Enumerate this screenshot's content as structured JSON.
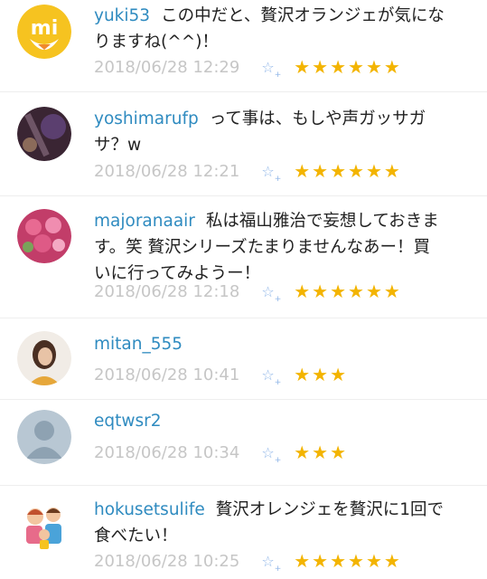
{
  "comments": [
    {
      "user": "yuki53",
      "lines": [
        "この中だと、贅沢オランジェが気にな",
        "りますね(^^)！"
      ],
      "time": "2018/06/28 12:29",
      "stars": "★★★★★★"
    },
    {
      "user": "yoshimarufp",
      "lines": [
        "って事は、もしや声ガッサガ",
        "サ？w"
      ],
      "time": "2018/06/28 12:21",
      "stars": "★★★★★★"
    },
    {
      "user": "majoranaair",
      "lines": [
        "私は福山雅治で妄想しておきま",
        "す。笑 贅沢シリーズたまりませんなあー！買",
        "いに行ってみようー！"
      ],
      "time": "2018/06/28 12:18",
      "stars": "★★★★★★"
    },
    {
      "user": "mitan_555",
      "lines": [
        ""
      ],
      "time": "2018/06/28 10:41",
      "stars": "★★★"
    },
    {
      "user": "eqtwsr2",
      "lines": [
        ""
      ],
      "time": "2018/06/28 10:34",
      "stars": "★★★"
    },
    {
      "user": "hokusetsulife",
      "lines": [
        "贅沢オレンジェを贅沢に1回で",
        "食べたい！"
      ],
      "time": "2018/06/28 10:25",
      "stars": "★★★★★★"
    }
  ],
  "add_star_icon": "☆",
  "add_star_plus": "+",
  "avatar_logo_text": "mi"
}
